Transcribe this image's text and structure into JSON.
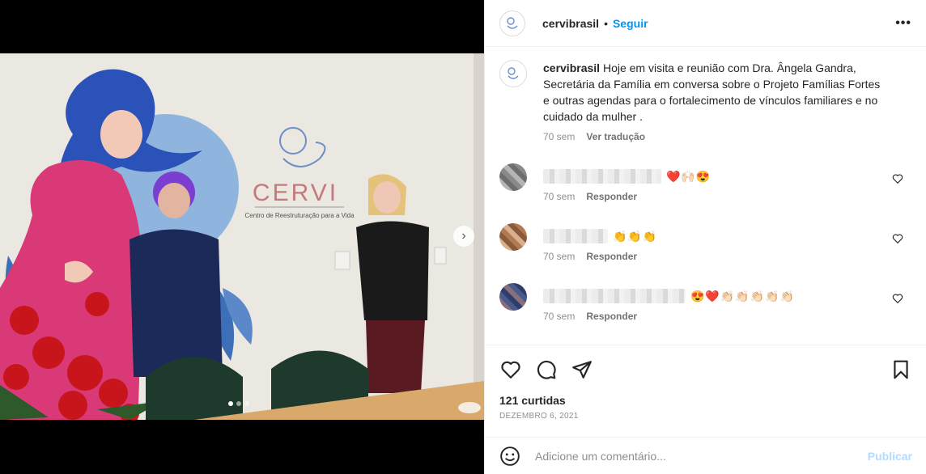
{
  "post": {
    "username": "cervibrasil",
    "separator": "•",
    "follow_label": "Seguir",
    "more_label": "•••",
    "caption": "Hoje em visita e reunião com Dra. Ângela Gandra, Secretária da Família em conversa sobre o Projeto Famílias Fortes e outras agendas para o fortalecimento de vínculos familiares e no cuidado da mulher .",
    "caption_time": "70 sem",
    "translate_label": "Ver tradução"
  },
  "photo": {
    "sign_brand": "CERVI",
    "sign_subtitle": "Centro de Reestruturação para a Vida",
    "next_label": "›",
    "slide_count": 3,
    "active_slide": 1
  },
  "comments": [
    {
      "emojis": "❤️🙌🏻😍",
      "time": "70 sem",
      "reply_label": "Responder"
    },
    {
      "emojis": "👏👏👏",
      "time": "70 sem",
      "reply_label": "Responder"
    },
    {
      "emojis": "😍❤️👏🏻👏🏻👏🏻👏🏻👏🏻",
      "time": "70 sem",
      "reply_label": "Responder"
    }
  ],
  "actions": {
    "likes": "121 curtidas",
    "date": "DEZEMBRO 6, 2021"
  },
  "add_comment": {
    "placeholder": "Adicione um comentário...",
    "publish_label": "Publicar"
  },
  "colors": {
    "link_blue": "#0095f6",
    "publish_disabled": "#b3dbff",
    "muted": "#8e8e8e",
    "heart_red": "#ed4956"
  }
}
